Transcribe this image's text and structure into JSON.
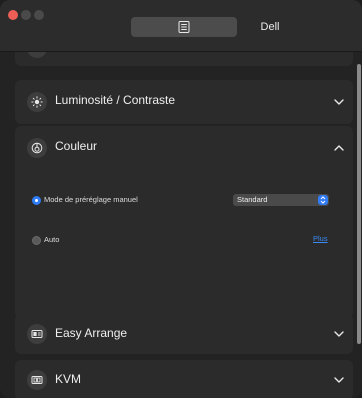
{
  "window": {
    "tabs": {
      "display_icon": "display-settings-icon",
      "dell_label": "Dell"
    }
  },
  "sections": {
    "partial_top_icon": "minus-icon",
    "brightness": {
      "label": "Luminosité / Contraste",
      "icon": "sun-icon",
      "state": "collapsed"
    },
    "color": {
      "label": "Couleur",
      "icon": "color-palette-icon",
      "state": "expanded",
      "options": {
        "manual_preset_label": "Mode de préréglage manuel",
        "manual_selected": true,
        "preset_value": "Standard",
        "auto_label": "Auto",
        "auto_selected": false,
        "more_link": "Plus"
      }
    },
    "easy_arrange": {
      "label": "Easy Arrange",
      "icon": "window-layout-icon",
      "state": "collapsed"
    },
    "kvm": {
      "label": "KVM",
      "icon": "kvm-icon",
      "state": "collapsed"
    }
  },
  "colors": {
    "accent": "#2f7cf6",
    "link": "#3b8bf7",
    "card_bg": "#2b2b2b",
    "window_bg": "#232323"
  }
}
